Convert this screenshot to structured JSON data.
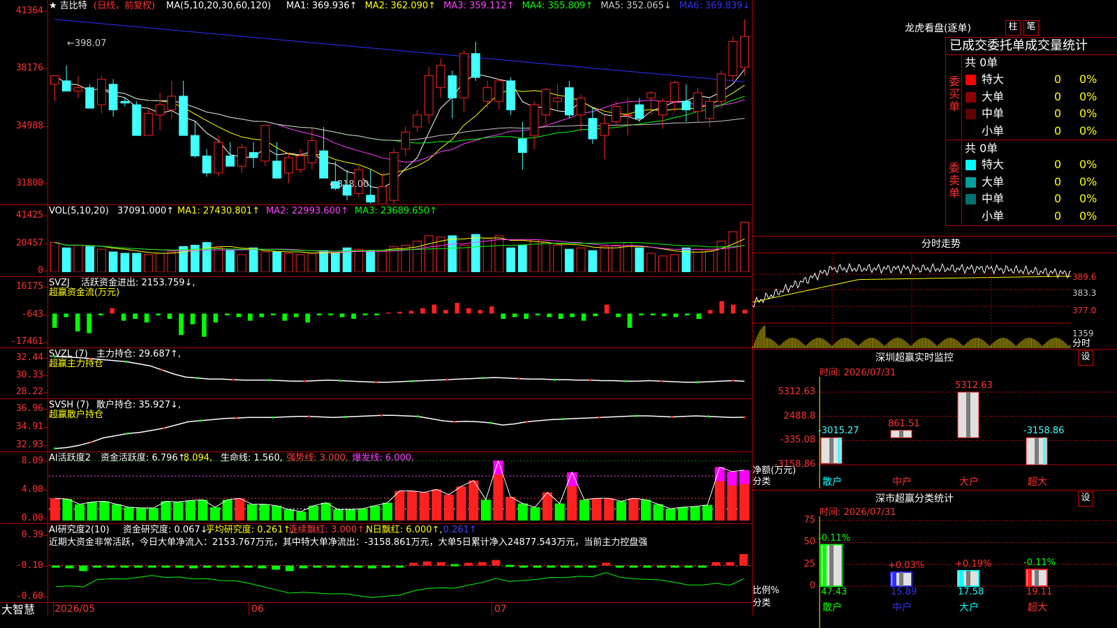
{
  "stock": {
    "name": "吉比特",
    "period": "(日线，前复权)"
  },
  "colors": {
    "up": "#ff2020",
    "down": "#40ffff",
    "bg": "#000000",
    "grid": "#b00000",
    "axis": "#ff3030"
  },
  "main_panel": {
    "ma_title": "MA(5,10,20,30,60,120)",
    "ma": [
      {
        "label": "MA1: 369.936↑",
        "color": "#ffffff"
      },
      {
        "label": "MA2: 362.090↑",
        "color": "#ffff00"
      },
      {
        "label": "MA3: 359.112↑",
        "color": "#ff40ff"
      },
      {
        "label": "MA4: 355.809↑",
        "color": "#00ff00"
      },
      {
        "label": "MA5: 352.065↓",
        "color": "#c8c8c8"
      },
      {
        "label": "MA6: 369.839↓",
        "color": "#3030ff"
      }
    ],
    "y_ticks": [
      "41364",
      "38176",
      "34988",
      "31800"
    ],
    "high_mark": "←398.07",
    "low_mark": "←318.00"
  },
  "vol_panel": {
    "title": "VOL(5,10,20)",
    "values": [
      {
        "label": "37091.000↑",
        "color": "#ffffff"
      },
      {
        "label": "MA1: 27430.801↑",
        "color": "#ffff00"
      },
      {
        "label": "MA2: 22993.600↑",
        "color": "#ff40ff"
      },
      {
        "label": "MA3: 23689.650↑",
        "color": "#00ff00"
      }
    ],
    "y_ticks": [
      "41425",
      "20457",
      "0"
    ]
  },
  "svzj_panel": {
    "title": "SVZJ",
    "label": "活跃资金进出: 2153.759↓,",
    "sublabel": "超赢资金流(万元)",
    "y_ticks": [
      "16175",
      "-643",
      "-17461"
    ]
  },
  "svzl_panel": {
    "title": "SVZL (7)",
    "label": "主力持仓: 29.687↑,",
    "sublabel": "超赢主力持仓",
    "y_ticks": [
      "32.44",
      "30.33",
      "28.22"
    ]
  },
  "svsh_panel": {
    "title": "SVSH (7)",
    "label": "散户持仓: 35.927↓,",
    "sublabel": "超赢散户持仓",
    "y_ticks": [
      "36.96",
      "34.91",
      "32.93"
    ]
  },
  "ai_active_panel": {
    "title": "AI活跃度2",
    "parts": [
      {
        "label": "资金活跃度: 6.796↑,",
        "color": "#ffffff"
      },
      {
        "label": "8.094,",
        "color": "#ffff00"
      },
      {
        "label": "生命线: 1.560,",
        "color": "#ffffff"
      },
      {
        "label": "强势线: 3.000,",
        "color": "#ff4040"
      },
      {
        "label": "爆发线: 6.000,",
        "color": "#ff40ff"
      }
    ],
    "y_ticks": [
      "8.09",
      "4.00",
      "0.00"
    ]
  },
  "ai_research_panel": {
    "title": "AI研究度2(10)",
    "parts": [
      {
        "label": "资金研究度: 0.067↓,",
        "color": "#ffffff"
      },
      {
        "label": "平均研究度: 0.261↑,",
        "color": "#ffff00"
      },
      {
        "label": "连续飘红: 3.000↑,",
        "color": "#ff4040"
      },
      {
        "label": "N日飘红: 6.000↑,",
        "color": "#ffff00"
      },
      {
        "label": "0.261↑",
        "color": "#4040ff"
      }
    ],
    "commentary": "近期大资金非常活跃，今日大单净流入：2153.767万元，其中特大单净流出：-3158.861万元，大单5日累计净入24877.543万元，当前主力控盘强",
    "y_ticks": [
      "0.39",
      "-0.10",
      "-0.60"
    ]
  },
  "x_axis": {
    "labels": [
      "2026/05",
      "06",
      "07"
    ],
    "brand": "大智慧"
  },
  "right_panel": {
    "dragon_title": "龙虎看盘(逐单)",
    "tab1": "柱",
    "tab2": "笔",
    "stats_header": "已成交委托单成交量统计",
    "buy": {
      "side": "委买单",
      "total": "共 0单",
      "rows": [
        {
          "name": "特大",
          "count": "0",
          "pct": "0%",
          "color": "#ff0000"
        },
        {
          "name": "大单",
          "count": "0",
          "pct": "0%",
          "color": "#900000"
        },
        {
          "name": "中单",
          "count": "0",
          "pct": "0%",
          "color": "#600000"
        },
        {
          "name": "小单",
          "count": "0",
          "pct": "0%",
          "color": "#000000"
        }
      ]
    },
    "sell": {
      "side": "委卖单",
      "total": "共 0单",
      "rows": [
        {
          "name": "特大",
          "count": "0",
          "pct": "0%",
          "color": "#00ffff"
        },
        {
          "name": "大单",
          "count": "0",
          "pct": "0%",
          "color": "#00a0a0"
        },
        {
          "name": "中单",
          "count": "0",
          "pct": "0%",
          "color": "#007070"
        },
        {
          "name": "小单",
          "count": "0",
          "pct": "0%",
          "color": "#000000"
        }
      ]
    },
    "intraday": {
      "title": "分时走势",
      "price_ticks": [
        "389.6",
        "383.3",
        "377.0"
      ],
      "vol_tick": "1359",
      "vol_label": "分时"
    },
    "monitor": {
      "title": "深圳超赢实时监控",
      "settings": "设",
      "time_label": "时间: 2026/07/31",
      "y_ticks": [
        "5312.63",
        "2488.8",
        "-335.08",
        "-3158.86"
      ],
      "y_caption": "净额(万元)",
      "x_caption": "分类",
      "categories": [
        "散户",
        "中户",
        "大户",
        "超大"
      ]
    },
    "classify": {
      "title": "深市超赢分类统计",
      "settings": "设",
      "time_label": "时间: 2026/07/31",
      "y_ticks": [
        "75",
        "50",
        "25",
        "0"
      ],
      "y_caption": "比例%",
      "x_caption": "分类",
      "categories": [
        "散户",
        "中户",
        "大户",
        "超大"
      ],
      "changes": [
        "-0.11%",
        "+0.03%",
        "+0.19%",
        "-0.11%"
      ],
      "values": [
        "47.43",
        "15.89",
        "17.58",
        "19.11"
      ]
    }
  },
  "chart_data": [
    {
      "type": "candlestick",
      "title": "吉比特 (日线，前复权)",
      "ylim": [
        31800,
        41364
      ],
      "x_labels": [
        "2026/05",
        "06",
        "07"
      ],
      "ohlc": [
        [
          370,
          375,
          360,
          375
        ],
        [
          372,
          381,
          366,
          366
        ],
        [
          366,
          375,
          362,
          368
        ],
        [
          368,
          370,
          356,
          356
        ],
        [
          358,
          375,
          353,
          373
        ],
        [
          370,
          373,
          351,
          355
        ],
        [
          360,
          362,
          357,
          359
        ],
        [
          358,
          360,
          340,
          340
        ],
        [
          340,
          356,
          340,
          353
        ],
        [
          352,
          365,
          343,
          358
        ],
        [
          355,
          372,
          350,
          363
        ],
        [
          363,
          372,
          340,
          340
        ],
        [
          340,
          348,
          327,
          328
        ],
        [
          328,
          332,
          316,
          318
        ],
        [
          318,
          340,
          316,
          336
        ],
        [
          328,
          336,
          322,
          322
        ],
        [
          322,
          335,
          318,
          333
        ],
        [
          330,
          336,
          321,
          327
        ],
        [
          325,
          346,
          322,
          346
        ],
        [
          325,
          336,
          315,
          315
        ],
        [
          318,
          330,
          312,
          327
        ],
        [
          320,
          332,
          318,
          328
        ],
        [
          324,
          345,
          320,
          337
        ],
        [
          331,
          345,
          315,
          315
        ],
        [
          313,
          325,
          308,
          309
        ],
        [
          311,
          320,
          302,
          305
        ],
        [
          306,
          322,
          304,
          320
        ],
        [
          305,
          320,
          300,
          301
        ],
        [
          300,
          318,
          300,
          310
        ],
        [
          302,
          332,
          300,
          330
        ],
        [
          332,
          345,
          328,
          342
        ],
        [
          345,
          355,
          342,
          352
        ],
        [
          352,
          380,
          347,
          375
        ],
        [
          368,
          385,
          362,
          381
        ],
        [
          375,
          378,
          350,
          362
        ],
        [
          362,
          390,
          354,
          388
        ],
        [
          388,
          395,
          372,
          374
        ],
        [
          360,
          372,
          356,
          368
        ],
        [
          360,
          373,
          355,
          372
        ],
        [
          372,
          374,
          352,
          355
        ],
        [
          338,
          348,
          320,
          330
        ],
        [
          340,
          360,
          332,
          358
        ],
        [
          352,
          368,
          345,
          367
        ],
        [
          360,
          370,
          355,
          362
        ],
        [
          368,
          372,
          350,
          352
        ],
        [
          352,
          364,
          342,
          362
        ],
        [
          350,
          356,
          335,
          338
        ],
        [
          340,
          352,
          326,
          347
        ],
        [
          348,
          360,
          345,
          357
        ],
        [
          352,
          362,
          340,
          352
        ],
        [
          358,
          362,
          348,
          350
        ],
        [
          362,
          366,
          352,
          365
        ],
        [
          352,
          362,
          344,
          360
        ],
        [
          360,
          372,
          354,
          371
        ],
        [
          360,
          370,
          348,
          355
        ],
        [
          354,
          368,
          348,
          365
        ],
        [
          350,
          362,
          345,
          360
        ],
        [
          360,
          378,
          356,
          376
        ],
        [
          375,
          398,
          372,
          395
        ],
        [
          380,
          408,
          375,
          398
        ]
      ]
    },
    {
      "type": "bar",
      "title": "VOL(5,10,20)",
      "ylim": [
        0,
        41425
      ],
      "values": [
        22000,
        18000,
        20000,
        19000,
        17000,
        15000,
        14000,
        14000,
        13000,
        14000,
        15000,
        19000,
        20000,
        22000,
        18000,
        16000,
        13000,
        18000,
        15000,
        15000,
        14000,
        13000,
        14000,
        16000,
        14000,
        18000,
        17000,
        16000,
        16000,
        19000,
        20000,
        23000,
        27000,
        26000,
        27000,
        20000,
        28000,
        25000,
        27000,
        18000,
        20000,
        24000,
        22000,
        20000,
        17000,
        18000,
        16000,
        19000,
        20000,
        22000,
        18000,
        14000,
        12000,
        13000,
        18000,
        17000,
        16000,
        23000,
        30000,
        37091
      ],
      "colors_up_down": "up=red hollow, down=cyan solid"
    },
    {
      "type": "bar",
      "title": "超赢资金流(万元)",
      "ylim": [
        -17461,
        16175
      ],
      "values": [
        -8000,
        -2000,
        -10000,
        -11000,
        -1000,
        3000,
        -4000,
        -3000,
        -5000,
        -1000,
        -3000,
        -12000,
        -6000,
        -13000,
        -5000,
        -1000,
        -2000,
        -4000,
        -2000,
        -1000,
        -4000,
        -2000,
        -5000,
        -1000,
        -1000,
        -2000,
        -3000,
        -1000,
        -1000,
        500,
        1000,
        1500,
        3000,
        5000,
        2000,
        6000,
        3000,
        2000,
        4000,
        -3000,
        -2000,
        -3000,
        -1000,
        -2000,
        -3000,
        -2000,
        -4000,
        -1500,
        5000,
        -2000,
        -8000,
        -1000,
        -1000,
        -1500,
        -2000,
        -1000,
        -3000,
        2000,
        7000,
        5000,
        2154
      ]
    },
    {
      "type": "line",
      "title": "超赢主力持仓",
      "ylim": [
        28.22,
        32.44
      ],
      "values": [
        32.1,
        32.05,
        32.0,
        31.9,
        31.8,
        31.7,
        31.6,
        31.4,
        31.2,
        30.8,
        30.4,
        30.1,
        30.0,
        29.9,
        29.9,
        29.85,
        29.8,
        29.8,
        29.8,
        29.75,
        29.7,
        29.7,
        29.75,
        29.8,
        29.75,
        29.7,
        29.65,
        29.6,
        29.6,
        29.65,
        29.7,
        29.75,
        29.8,
        29.85,
        29.9,
        29.95,
        30.0,
        30.05,
        30.0,
        29.95,
        29.9,
        29.9,
        29.85,
        29.85,
        29.8,
        29.8,
        29.75,
        29.75,
        29.7,
        29.7,
        29.75,
        29.7,
        29.65,
        29.6,
        29.6,
        29.65,
        29.7,
        29.75,
        29.687
      ]
    },
    {
      "type": "line",
      "title": "超赢散户持仓",
      "ylim": [
        32.93,
        36.96
      ],
      "values": [
        33.0,
        33.1,
        33.3,
        33.6,
        34.0,
        34.2,
        34.4,
        34.5,
        34.7,
        34.9,
        35.2,
        35.5,
        35.6,
        35.7,
        35.8,
        35.85,
        35.9,
        35.9,
        35.9,
        35.95,
        36.0,
        36.0,
        35.95,
        35.9,
        35.95,
        36.0,
        36.05,
        36.1,
        36.1,
        36.05,
        36.0,
        35.8,
        35.6,
        35.5,
        35.55,
        35.5,
        35.4,
        35.2,
        35.3,
        35.5,
        35.6,
        35.7,
        35.75,
        35.8,
        35.85,
        35.9,
        35.95,
        36.0,
        36.05,
        36.05,
        36.0,
        35.95,
        36.0,
        36.05,
        36.0,
        35.95,
        35.9,
        35.927
      ]
    },
    {
      "type": "bar",
      "title": "AI活跃度2",
      "ylim": [
        0,
        8.09
      ],
      "values": [
        3.0,
        2.9,
        2.2,
        2.5,
        2.6,
        2.2,
        1.8,
        1.7,
        1.7,
        2.6,
        2.5,
        2.7,
        2.8,
        1.8,
        2.8,
        3.0,
        2.2,
        2.2,
        2.0,
        1.5,
        1.2,
        2.0,
        2.4,
        1.5,
        1.5,
        1.6,
        2.0,
        2.4,
        4.0,
        4.0,
        3.8,
        4.2,
        3.5,
        4.6,
        5.4,
        2.8,
        8.09,
        3.2,
        2.3,
        1.8,
        3.8,
        2.3,
        6.5,
        2.8,
        3.0,
        3.0,
        2.6,
        3.0,
        2.8,
        2.2,
        1.6,
        1.8,
        1.9,
        2.1,
        7.2,
        6.6,
        6.796
      ]
    },
    {
      "type": "bar",
      "title": "AI研究度2(10)",
      "ylim": [
        -0.6,
        0.39
      ],
      "values": [
        -0.12,
        -0.14,
        -0.18,
        -0.1,
        -0.11,
        -0.13,
        -0.12,
        -0.1,
        -0.13,
        -0.12,
        -0.14,
        -0.12,
        -0.13,
        -0.11,
        -0.12,
        -0.14,
        -0.16,
        -0.18,
        -0.14,
        -0.13,
        -0.12,
        -0.1,
        -0.12,
        -0.14,
        -0.12,
        -0.11,
        -0.06,
        -0.04,
        -0.05,
        -0.08,
        -0.06,
        -0.05,
        -0.02,
        -0.09,
        -0.1,
        -0.11,
        -0.1,
        -0.12,
        -0.11,
        -0.12,
        -0.06,
        -0.12,
        -0.13,
        -0.12,
        -0.11,
        -0.12,
        -0.13,
        -0.1,
        -0.05,
        -0.05,
        0.067
      ]
    },
    {
      "type": "bar",
      "title": "深圳超赢实时监控",
      "ylim": [
        -3158.86,
        5312.63
      ],
      "categories": [
        "散户",
        "中户",
        "大户",
        "超大"
      ],
      "values": [
        -3015.27,
        861.51,
        5312.63,
        -3158.86
      ]
    },
    {
      "type": "bar",
      "title": "深市超赢分类统计",
      "ylim": [
        0,
        75
      ],
      "categories": [
        "散户",
        "中户",
        "大户",
        "超大"
      ],
      "values": [
        47.43,
        15.89,
        17.58,
        19.11
      ]
    }
  ]
}
